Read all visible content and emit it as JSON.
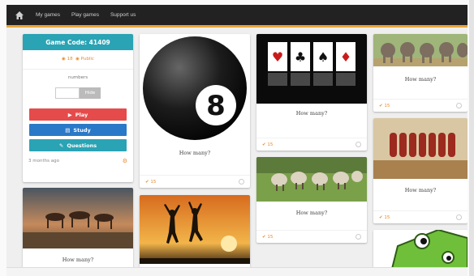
{
  "nav": {
    "my_games": "My games",
    "play_games": "Play games",
    "support_us": "Support us"
  },
  "game": {
    "code_label": "Game Code: 41409",
    "plays": "18",
    "likes": "Public",
    "topic": "numbers",
    "hide_label": "Hide",
    "play_label": "Play",
    "study_label": "Study",
    "questions_label": "Questions",
    "age": "3 months ago"
  },
  "cards": [
    {
      "caption": "How many?",
      "likes": "15"
    },
    {
      "caption": "How many?",
      "likes": "15"
    },
    {
      "caption": "How many?",
      "likes": "15"
    },
    {
      "caption": "How many?",
      "likes": "15"
    },
    {
      "caption": "How many?",
      "likes": "15"
    },
    {
      "caption": "How many?"
    }
  ],
  "colors": {
    "header": "#2aa3b4",
    "play": "#e54b4b",
    "study": "#2a79c8",
    "accent": "#e8a53b",
    "navbar": "#222222"
  }
}
